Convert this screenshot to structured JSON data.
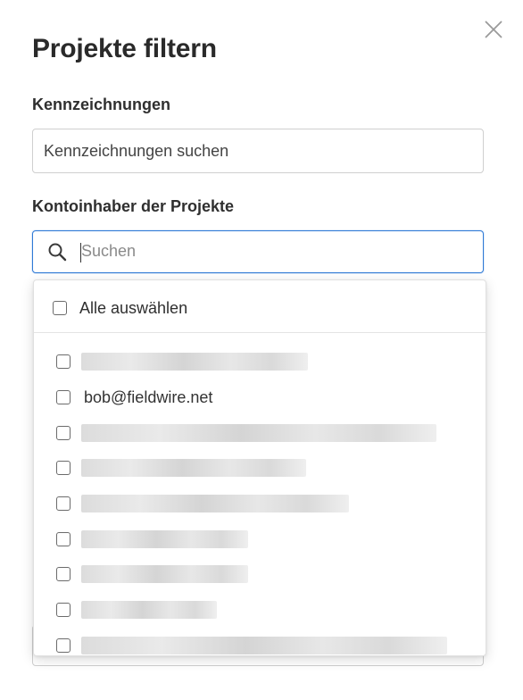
{
  "dialog": {
    "title": "Projekte filtern",
    "close_icon": "close-icon"
  },
  "tags": {
    "label": "Kennzeichnungen",
    "placeholder": "Kennzeichnungen suchen"
  },
  "owners": {
    "label": "Kontoinhaber der Projekte",
    "search_placeholder": "Suchen",
    "search_icon": "search-icon",
    "select_all_label": "Alle auswählen",
    "items": [
      {
        "label": "",
        "redacted": true,
        "checked": false
      },
      {
        "label": "bob@fieldwire.net",
        "redacted": false,
        "checked": false
      },
      {
        "label": "",
        "redacted": true,
        "checked": false
      },
      {
        "label": "",
        "redacted": true,
        "checked": false
      },
      {
        "label": "",
        "redacted": true,
        "checked": false
      },
      {
        "label": "",
        "redacted": true,
        "checked": false
      },
      {
        "label": "",
        "redacted": true,
        "checked": false
      },
      {
        "label": "",
        "redacted": true,
        "checked": false
      },
      {
        "label": "",
        "redacted": true,
        "checked": false
      }
    ]
  },
  "colors": {
    "focus_border": "#2f7ad6",
    "text": "#2b2b2b",
    "border": "#cfcfcf"
  }
}
